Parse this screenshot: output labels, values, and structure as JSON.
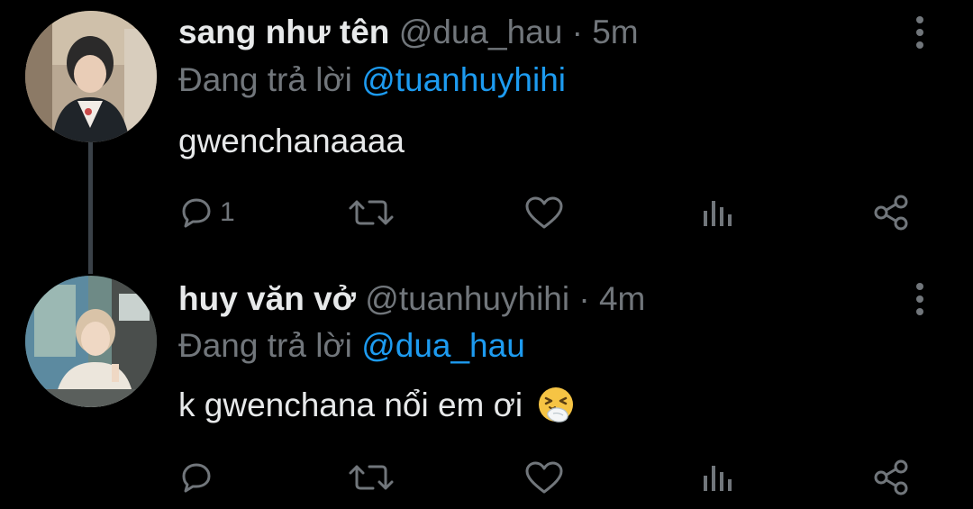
{
  "tweets": [
    {
      "display_name": "sang như tên",
      "handle": "@dua_hau",
      "separator": "·",
      "time": "5m",
      "replying_prefix": "Đang trả lời",
      "replying_to": "@tuanhuyhihi",
      "text": "gwenchanaaaa",
      "emoji": "",
      "reply_count": "1",
      "avatar": "avatar-photo"
    },
    {
      "display_name": "huy văn vở",
      "handle": "@tuanhuyhihi",
      "separator": "·",
      "time": "4m",
      "replying_prefix": "Đang trả lời",
      "replying_to": "@dua_hau",
      "text": "k gwenchana nổi em ơi",
      "emoji": "sneezing-face",
      "reply_count": "",
      "avatar": "avatar-photo"
    }
  ],
  "icons": {
    "reply": "reply-icon",
    "retweet": "retweet-icon",
    "like": "like-icon",
    "views": "views-icon",
    "share": "share-icon",
    "more": "more-vertical-icon"
  },
  "colors": {
    "background": "#000000",
    "primary_text": "#e7e9ea",
    "secondary_text": "#71767b",
    "accent": "#1d9bf0",
    "thread_line": "#3a4148"
  }
}
